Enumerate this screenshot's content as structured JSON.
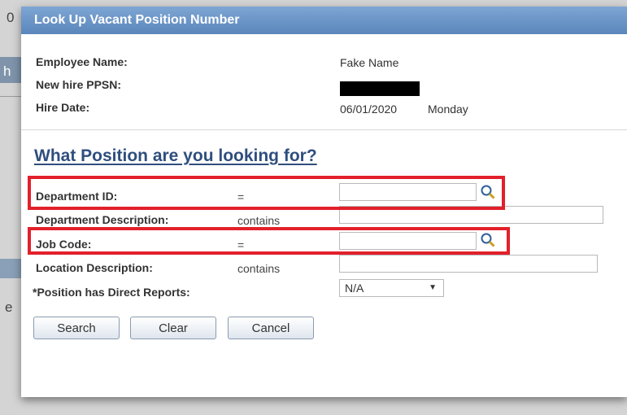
{
  "background": {
    "glyph_top": "0",
    "glyph_h": "h",
    "glyph_e": "e"
  },
  "dialog": {
    "title": "Look Up Vacant Position Number",
    "info": [
      {
        "label": "Employee Name:",
        "value": "Fake  Name"
      },
      {
        "label": "New hire PPSN:",
        "value": ""
      },
      {
        "label": "Hire Date:",
        "value": "06/01/2020",
        "extra": "Monday"
      }
    ],
    "heading": "What Position are you looking for?",
    "criteria": [
      {
        "label": "Department ID:",
        "operator": "=",
        "value": "",
        "icon": "lookup-icon"
      },
      {
        "label": "Department Description:",
        "operator": "contains",
        "value": ""
      },
      {
        "label": "Job Code:",
        "operator": "=",
        "value": "",
        "icon": "lookup-icon"
      },
      {
        "label": "Location Description:",
        "operator": "contains",
        "value": ""
      },
      {
        "label": "*Position has Direct Reports:",
        "selected": "N/A",
        "icon": "dropdown-arrow-icon"
      }
    ],
    "buttons": {
      "search": "Search",
      "clear": "Clear",
      "cancel": "Cancel"
    },
    "colors": {
      "title_bar": "#6b95c8",
      "heading": "#2f4e7e",
      "highlight": "#e2202b"
    }
  }
}
